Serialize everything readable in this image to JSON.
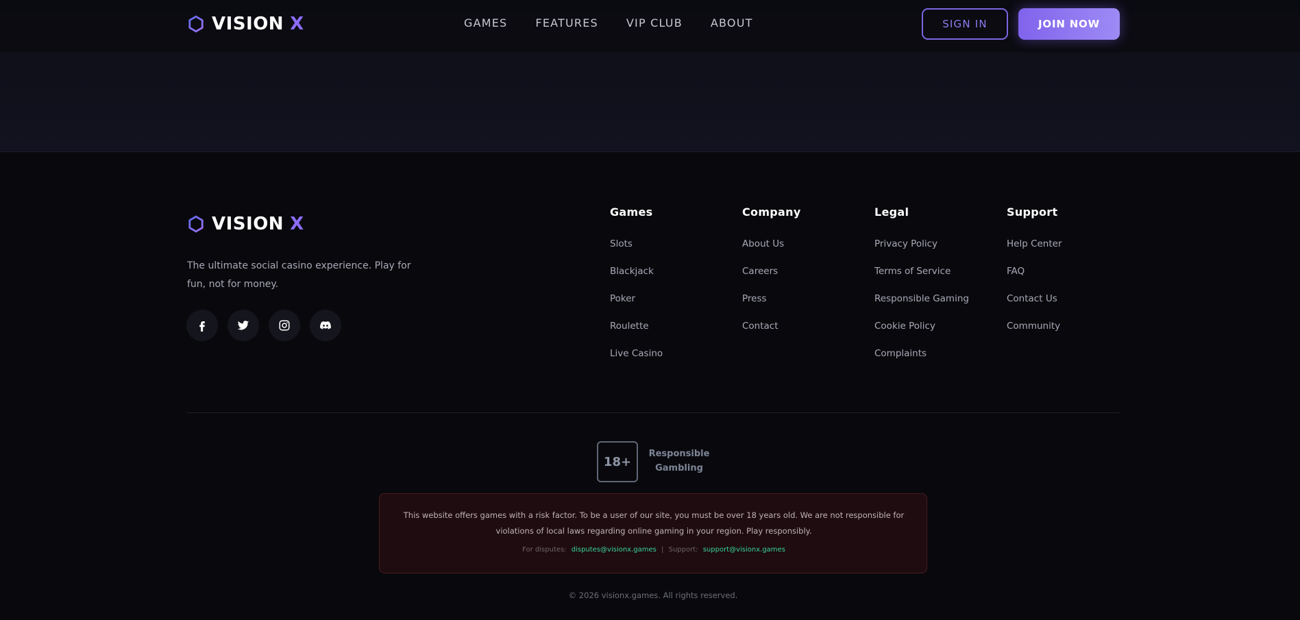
{
  "header": {
    "brand": {
      "name": "VISION",
      "accent": "X"
    },
    "nav": [
      "GAMES",
      "FEATURES",
      "VIP CLUB",
      "ABOUT"
    ],
    "sign_in": "SIGN IN",
    "join_now": "JOIN NOW"
  },
  "footer": {
    "brand": {
      "name": "VISION",
      "accent": "X"
    },
    "description": "The ultimate social casino experience. Play for fun, not for money.",
    "socials": [
      "facebook-icon",
      "twitter-icon",
      "instagram-icon",
      "discord-icon"
    ],
    "columns": [
      {
        "title": "Games",
        "links": [
          "Slots",
          "Blackjack",
          "Poker",
          "Roulette",
          "Live Casino"
        ]
      },
      {
        "title": "Company",
        "links": [
          "About Us",
          "Careers",
          "Press",
          "Contact"
        ]
      },
      {
        "title": "Legal",
        "links": [
          "Privacy Policy",
          "Terms of Service",
          "Responsible Gaming",
          "Cookie Policy",
          "Complaints"
        ]
      },
      {
        "title": "Support",
        "links": [
          "Help Center",
          "FAQ",
          "Contact Us",
          "Community"
        ]
      }
    ],
    "age_badge": "18+",
    "responsible_label": "Responsible Gambling",
    "warning": {
      "text": "This website offers games with a risk factor. To be a user of our site, you must be over 18 years old. We are not responsible for violations of local laws regarding online gaming in your region. Play responsibly.",
      "disputes_label": "For disputes:",
      "disputes_email": "disputes@visionx.games",
      "separator": "|",
      "support_label": "Support:",
      "support_email": "support@visionx.games"
    },
    "copyright": "© 2026 visionx.games. All rights reserved."
  },
  "colors": {
    "accent": "#8b6cf6",
    "background": "#09090d",
    "email_link": "#39d39a",
    "warning_bg": "#1e0c10"
  }
}
